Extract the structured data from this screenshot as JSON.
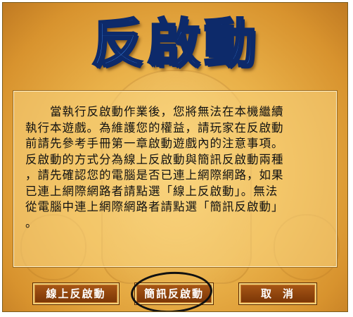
{
  "dialog": {
    "title": "反啟動",
    "message": "　　當執行反啟動作業後，您將無法在本機繼續執行本遊戲。為維護您的權益，請玩家在反啟動前請先參考手冊第一章啟動遊戲內的注意事項。反啟動的方式分為線上反啟動與簡訊反啟動兩種，請先確認您的電腦是否已連上網際網路，如果已連上網際網路者請點選「線上反啟動」。無法從電腦中連上網際網路者請點選「簡訊反啟動」。"
  },
  "buttons": {
    "online_label": "線上反啟動",
    "sms_label": "簡訊反啟動",
    "cancel_label": "取消"
  },
  "colors": {
    "title_fill": "#3f8cf0",
    "title_outline": "#0d2a6a",
    "background": "#eab24a",
    "button_fill": "#8e4510",
    "button_border": "#f3d27c",
    "annotation": "#111111"
  }
}
